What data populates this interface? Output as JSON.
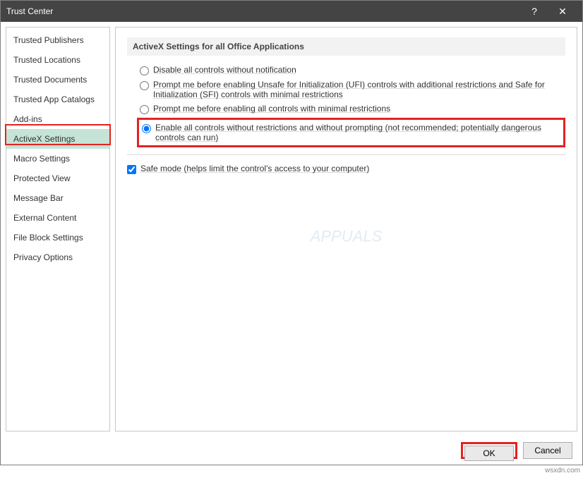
{
  "title": "Trust Center",
  "titlebar_help": "?",
  "titlebar_close": "✕",
  "sidebar": {
    "items": [
      {
        "label": "Trusted Publishers"
      },
      {
        "label": "Trusted Locations"
      },
      {
        "label": "Trusted Documents"
      },
      {
        "label": "Trusted App Catalogs"
      },
      {
        "label": "Add-ins"
      },
      {
        "label": "ActiveX Settings",
        "selected": true
      },
      {
        "label": "Macro Settings"
      },
      {
        "label": "Protected View"
      },
      {
        "label": "Message Bar"
      },
      {
        "label": "External Content"
      },
      {
        "label": "File Block Settings"
      },
      {
        "label": "Privacy Options"
      }
    ]
  },
  "content": {
    "header": "ActiveX Settings for all Office Applications",
    "radios": [
      {
        "label": "Disable all controls without notification",
        "checked": false
      },
      {
        "label": "Prompt me before enabling Unsafe for Initialization (UFI) controls with additional restrictions and Safe for Initialization (SFI) controls with minimal restrictions",
        "checked": false
      },
      {
        "label": "Prompt me before enabling all controls with minimal restrictions",
        "checked": false
      },
      {
        "label": "Enable all controls without restrictions and without prompting (not recommended; potentially dangerous controls can run)",
        "checked": true
      }
    ],
    "checkbox": {
      "label": "Safe mode (helps limit the control's access to your computer)",
      "checked": true
    }
  },
  "footer": {
    "ok": "OK",
    "cancel": "Cancel"
  },
  "watermark": "APPUALS",
  "credit": "wsxdn.com"
}
